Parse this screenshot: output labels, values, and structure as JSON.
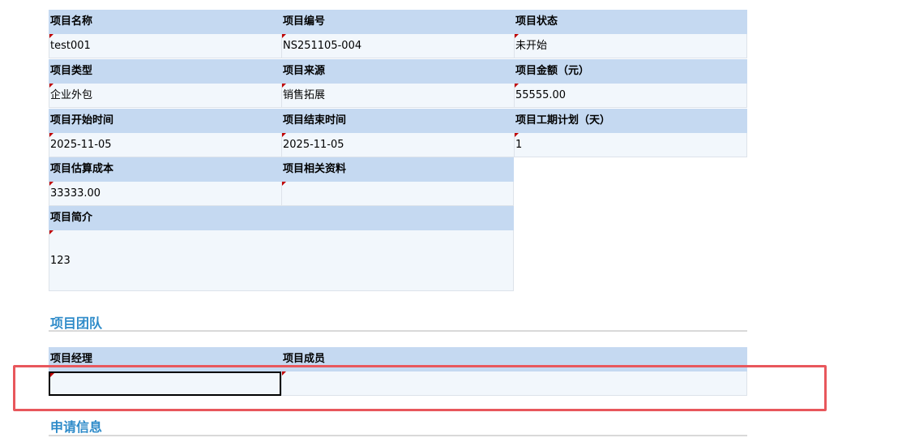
{
  "fields": {
    "project_name": {
      "label": "项目名称",
      "value": "test001"
    },
    "project_code": {
      "label": "项目编号",
      "value": "NS251105-004"
    },
    "project_status": {
      "label": "项目状态",
      "value": "未开始"
    },
    "project_type": {
      "label": "项目类型",
      "value": "企业外包"
    },
    "project_source": {
      "label": "项目来源",
      "value": "销售拓展"
    },
    "project_amount": {
      "label": "项目金额（元）",
      "value": "55555.00"
    },
    "start_time": {
      "label": "项目开始时间",
      "value": "2025-11-05"
    },
    "end_time": {
      "label": "项目结束时间",
      "value": "2025-11-05"
    },
    "duration_plan": {
      "label": "项目工期计划（天）",
      "value": "1"
    },
    "estimated_cost": {
      "label": "项目估算成本",
      "value": "33333.00"
    },
    "related_docs": {
      "label": "项目相关资料",
      "value": ""
    },
    "intro": {
      "label": "项目简介",
      "value": "123"
    }
  },
  "team": {
    "title": "项目团队",
    "manager": {
      "label": "项目经理",
      "value": ""
    },
    "members": {
      "label": "项目成员",
      "value": ""
    }
  },
  "application": {
    "title": "申请信息"
  }
}
